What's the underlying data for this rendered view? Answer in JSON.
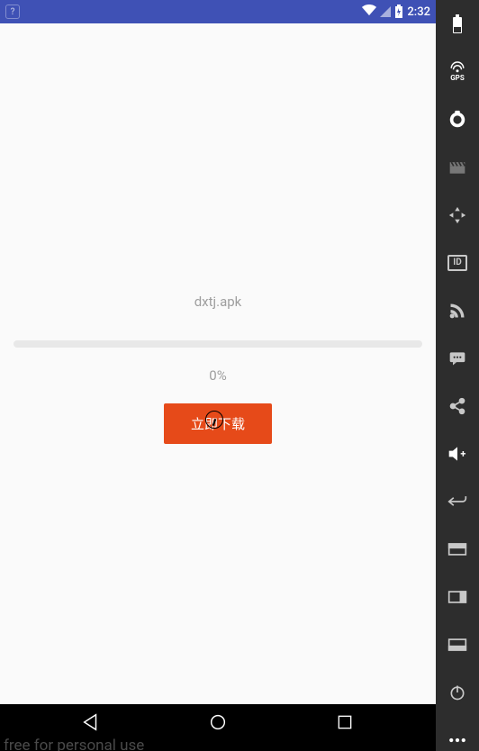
{
  "statusbar": {
    "time": "2:32",
    "help_icon": "?"
  },
  "app": {
    "filename": "dxtj.apk",
    "percent": "0%",
    "download_button": "立即下载"
  },
  "navbar": {
    "back": "back",
    "home": "home",
    "recents": "recents"
  },
  "emu": {
    "gps_label": "GPS",
    "id_label": "ID"
  },
  "watermark": "free for personal use"
}
